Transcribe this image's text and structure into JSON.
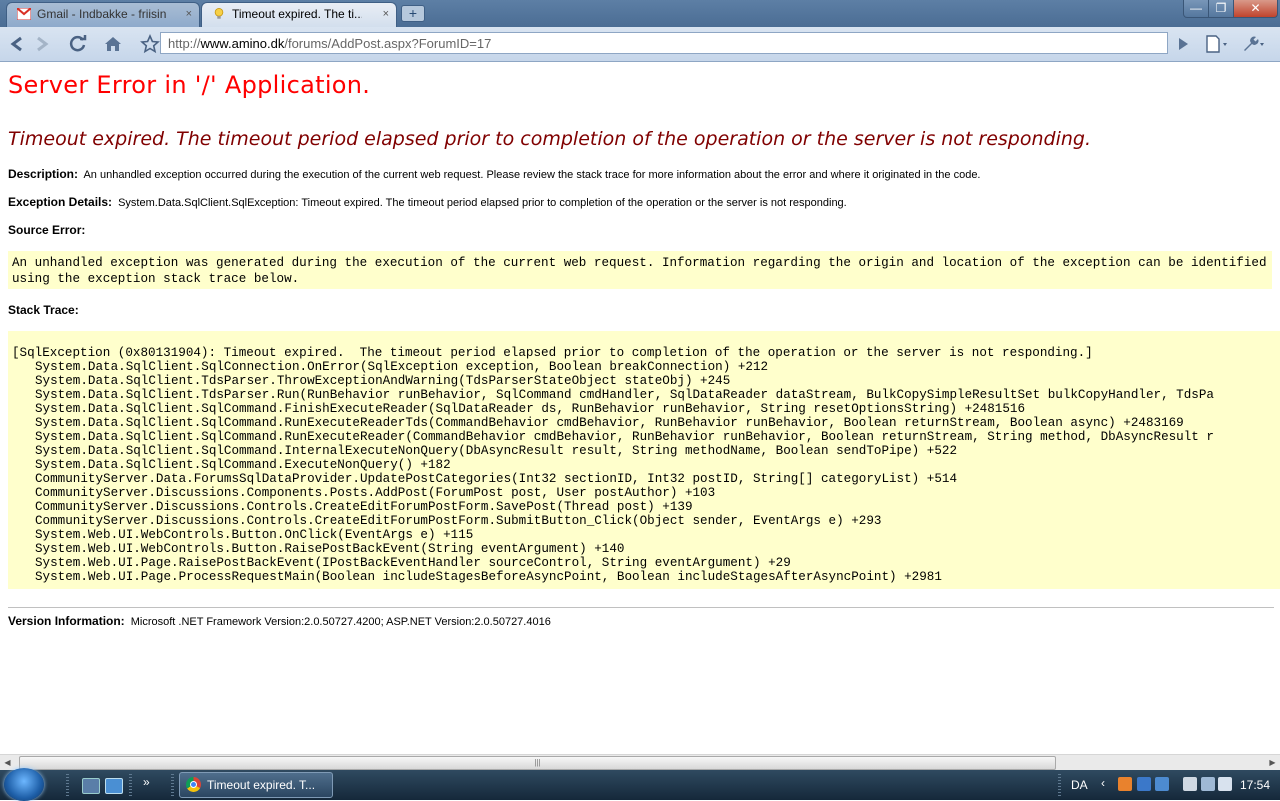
{
  "browser": {
    "tabs": [
      {
        "title": "Gmail - Indbakke - friisin...",
        "close": "×",
        "icon": "gmail-icon"
      },
      {
        "title": "Timeout expired.  The ti...",
        "close": "×",
        "icon": "lightbulb-icon"
      }
    ],
    "new_tab_label": "+",
    "address": {
      "scheme": "http://",
      "host": "www.amino.dk",
      "path": "/forums/AddPost.aspx?ForumID=17"
    },
    "window_buttons": {
      "minimize": "—",
      "maximize": "❐",
      "close": "✕"
    },
    "nav_icons": {
      "back": "back-arrow-icon",
      "forward": "forward-arrow-icon",
      "reload": "reload-icon",
      "home": "home-icon",
      "star": "star-icon",
      "go": "go-arrow-icon",
      "page": "page-menu-icon",
      "wrench": "wrench-icon"
    }
  },
  "page": {
    "title": "Server Error in '/' Application.",
    "heading": "Timeout expired.  The timeout period elapsed prior to completion of the operation or the server is not responding.",
    "description_label": "Description:",
    "description_text": "An unhandled exception occurred during the execution of the current web request. Please review the stack trace for more information about the error and where it originated in the code.",
    "exception_label": "Exception Details:",
    "exception_text": "System.Data.SqlClient.SqlException: Timeout expired.  The timeout period elapsed prior to completion of the operation or the server is not responding.",
    "source_error_label": "Source Error:",
    "source_error_text": "An unhandled exception was generated during the execution of the current web request. Information regarding the origin and location of the exception can be identified using the exception stack trace below.",
    "stack_trace_label": "Stack Trace:",
    "stack_trace": [
      "[SqlException (0x80131904): Timeout expired.  The timeout period elapsed prior to completion of the operation or the server is not responding.]",
      "System.Data.SqlClient.SqlConnection.OnError(SqlException exception, Boolean breakConnection) +212",
      "System.Data.SqlClient.TdsParser.ThrowExceptionAndWarning(TdsParserStateObject stateObj) +245",
      "System.Data.SqlClient.TdsParser.Run(RunBehavior runBehavior, SqlCommand cmdHandler, SqlDataReader dataStream, BulkCopySimpleResultSet bulkCopyHandler, TdsPa",
      "System.Data.SqlClient.SqlCommand.FinishExecuteReader(SqlDataReader ds, RunBehavior runBehavior, String resetOptionsString) +2481516",
      "System.Data.SqlClient.SqlCommand.RunExecuteReaderTds(CommandBehavior cmdBehavior, RunBehavior runBehavior, Boolean returnStream, Boolean async) +2483169",
      "System.Data.SqlClient.SqlCommand.RunExecuteReader(CommandBehavior cmdBehavior, RunBehavior runBehavior, Boolean returnStream, String method, DbAsyncResult r",
      "System.Data.SqlClient.SqlCommand.InternalExecuteNonQuery(DbAsyncResult result, String methodName, Boolean sendToPipe) +522",
      "System.Data.SqlClient.SqlCommand.ExecuteNonQuery() +182",
      "CommunityServer.Data.ForumsSqlDataProvider.UpdatePostCategories(Int32 sectionID, Int32 postID, String[] categoryList) +514",
      "CommunityServer.Discussions.Components.Posts.AddPost(ForumPost post, User postAuthor) +103",
      "CommunityServer.Discussions.Controls.CreateEditForumPostForm.SavePost(Thread post) +139",
      "CommunityServer.Discussions.Controls.CreateEditForumPostForm.SubmitButton_Click(Object sender, EventArgs e) +293",
      "System.Web.UI.WebControls.Button.OnClick(EventArgs e) +115",
      "System.Web.UI.WebControls.Button.RaisePostBackEvent(String eventArgument) +140",
      "System.Web.UI.Page.RaisePostBackEvent(IPostBackEventHandler sourceControl, String eventArgument) +29",
      "System.Web.UI.Page.ProcessRequestMain(Boolean includeStagesBeforeAsyncPoint, Boolean includeStagesAfterAsyncPoint) +2981"
    ],
    "version_label": "Version Information:",
    "version_text": "Microsoft .NET Framework Version:2.0.50727.4200; ASP.NET Version:2.0.50727.4016"
  },
  "taskbar": {
    "task_label": "Timeout expired.  T...",
    "language": "DA",
    "clock": "17:54",
    "quicklaunch_more": "»",
    "tray_chevron": "‹"
  },
  "colors": {
    "error_title": "#ff0000",
    "error_heading": "#800000",
    "code_background": "#ffffcc"
  }
}
